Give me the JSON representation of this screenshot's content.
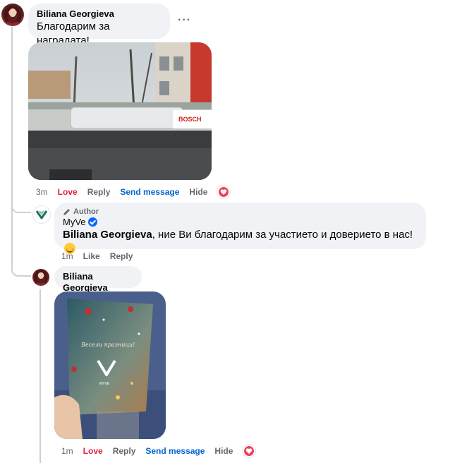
{
  "comments": [
    {
      "author": "Biliana Georgieva",
      "text": "Благодарим за наградата!",
      "more_icon": "ellipsis-icon",
      "photo_description_icon": "car-windshield-photo",
      "actions": {
        "time": "3m",
        "love": "Love",
        "reply": "Reply",
        "send": "Send message",
        "hide": "Hide"
      },
      "reaction": "heart-icon"
    },
    {
      "author_tag": "Author",
      "author": "MyVe",
      "mention": "Biliana Georgieva",
      "text": ", ние Ви благодарим за участието и доверието в нас!",
      "actions": {
        "time": "1m",
        "like": "Like",
        "reply": "Reply"
      }
    },
    {
      "author": "Biliana Georgieva",
      "photo_logo_text": "MYVE",
      "photo_greeting_text": "Весели празници!",
      "actions": {
        "time": "1m",
        "love": "Love",
        "reply": "Reply",
        "send": "Send message",
        "hide": "Hide"
      },
      "reaction": "heart-icon"
    }
  ],
  "colors": {
    "love": "#e41e3f",
    "link": "#0064d1",
    "bubble": "#f0f2f5",
    "meta": "#65676b",
    "verified": "#0866ff"
  }
}
